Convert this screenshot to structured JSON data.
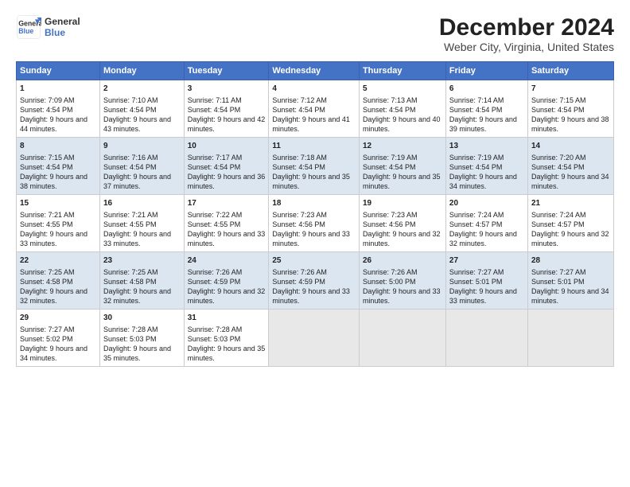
{
  "logo": {
    "line1": "General",
    "line2": "Blue"
  },
  "title": "December 2024",
  "subtitle": "Weber City, Virginia, United States",
  "days_of_week": [
    "Sunday",
    "Monday",
    "Tuesday",
    "Wednesday",
    "Thursday",
    "Friday",
    "Saturday"
  ],
  "weeks": [
    [
      {
        "day": 1,
        "sunrise": "7:09 AM",
        "sunset": "4:54 PM",
        "daylight": "9 hours and 44 minutes."
      },
      {
        "day": 2,
        "sunrise": "7:10 AM",
        "sunset": "4:54 PM",
        "daylight": "9 hours and 43 minutes."
      },
      {
        "day": 3,
        "sunrise": "7:11 AM",
        "sunset": "4:54 PM",
        "daylight": "9 hours and 42 minutes."
      },
      {
        "day": 4,
        "sunrise": "7:12 AM",
        "sunset": "4:54 PM",
        "daylight": "9 hours and 41 minutes."
      },
      {
        "day": 5,
        "sunrise": "7:13 AM",
        "sunset": "4:54 PM",
        "daylight": "9 hours and 40 minutes."
      },
      {
        "day": 6,
        "sunrise": "7:14 AM",
        "sunset": "4:54 PM",
        "daylight": "9 hours and 39 minutes."
      },
      {
        "day": 7,
        "sunrise": "7:15 AM",
        "sunset": "4:54 PM",
        "daylight": "9 hours and 38 minutes."
      }
    ],
    [
      {
        "day": 8,
        "sunrise": "7:15 AM",
        "sunset": "4:54 PM",
        "daylight": "9 hours and 38 minutes."
      },
      {
        "day": 9,
        "sunrise": "7:16 AM",
        "sunset": "4:54 PM",
        "daylight": "9 hours and 37 minutes."
      },
      {
        "day": 10,
        "sunrise": "7:17 AM",
        "sunset": "4:54 PM",
        "daylight": "9 hours and 36 minutes."
      },
      {
        "day": 11,
        "sunrise": "7:18 AM",
        "sunset": "4:54 PM",
        "daylight": "9 hours and 35 minutes."
      },
      {
        "day": 12,
        "sunrise": "7:19 AM",
        "sunset": "4:54 PM",
        "daylight": "9 hours and 35 minutes."
      },
      {
        "day": 13,
        "sunrise": "7:19 AM",
        "sunset": "4:54 PM",
        "daylight": "9 hours and 34 minutes."
      },
      {
        "day": 14,
        "sunrise": "7:20 AM",
        "sunset": "4:54 PM",
        "daylight": "9 hours and 34 minutes."
      }
    ],
    [
      {
        "day": 15,
        "sunrise": "7:21 AM",
        "sunset": "4:55 PM",
        "daylight": "9 hours and 33 minutes."
      },
      {
        "day": 16,
        "sunrise": "7:21 AM",
        "sunset": "4:55 PM",
        "daylight": "9 hours and 33 minutes."
      },
      {
        "day": 17,
        "sunrise": "7:22 AM",
        "sunset": "4:55 PM",
        "daylight": "9 hours and 33 minutes."
      },
      {
        "day": 18,
        "sunrise": "7:23 AM",
        "sunset": "4:56 PM",
        "daylight": "9 hours and 33 minutes."
      },
      {
        "day": 19,
        "sunrise": "7:23 AM",
        "sunset": "4:56 PM",
        "daylight": "9 hours and 32 minutes."
      },
      {
        "day": 20,
        "sunrise": "7:24 AM",
        "sunset": "4:57 PM",
        "daylight": "9 hours and 32 minutes."
      },
      {
        "day": 21,
        "sunrise": "7:24 AM",
        "sunset": "4:57 PM",
        "daylight": "9 hours and 32 minutes."
      }
    ],
    [
      {
        "day": 22,
        "sunrise": "7:25 AM",
        "sunset": "4:58 PM",
        "daylight": "9 hours and 32 minutes."
      },
      {
        "day": 23,
        "sunrise": "7:25 AM",
        "sunset": "4:58 PM",
        "daylight": "9 hours and 32 minutes."
      },
      {
        "day": 24,
        "sunrise": "7:26 AM",
        "sunset": "4:59 PM",
        "daylight": "9 hours and 32 minutes."
      },
      {
        "day": 25,
        "sunrise": "7:26 AM",
        "sunset": "4:59 PM",
        "daylight": "9 hours and 33 minutes."
      },
      {
        "day": 26,
        "sunrise": "7:26 AM",
        "sunset": "5:00 PM",
        "daylight": "9 hours and 33 minutes."
      },
      {
        "day": 27,
        "sunrise": "7:27 AM",
        "sunset": "5:01 PM",
        "daylight": "9 hours and 33 minutes."
      },
      {
        "day": 28,
        "sunrise": "7:27 AM",
        "sunset": "5:01 PM",
        "daylight": "9 hours and 34 minutes."
      }
    ],
    [
      {
        "day": 29,
        "sunrise": "7:27 AM",
        "sunset": "5:02 PM",
        "daylight": "9 hours and 34 minutes."
      },
      {
        "day": 30,
        "sunrise": "7:28 AM",
        "sunset": "5:03 PM",
        "daylight": "9 hours and 35 minutes."
      },
      {
        "day": 31,
        "sunrise": "7:28 AM",
        "sunset": "5:03 PM",
        "daylight": "9 hours and 35 minutes."
      },
      null,
      null,
      null,
      null
    ]
  ]
}
